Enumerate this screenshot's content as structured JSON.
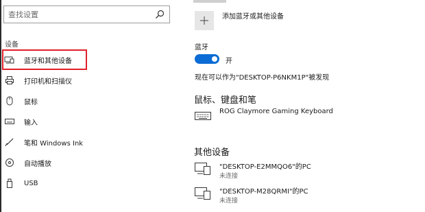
{
  "sidebar": {
    "search_placeholder": "查找设置",
    "section_label": "设备",
    "items": [
      {
        "label": "蓝牙和其他设备",
        "icon": "bluetooth-devices-icon"
      },
      {
        "label": "打印机和扫描仪",
        "icon": "printer-icon"
      },
      {
        "label": "鼠标",
        "icon": "mouse-icon"
      },
      {
        "label": "输入",
        "icon": "keyboard-icon"
      },
      {
        "label": "笔和 Windows Ink",
        "icon": "pen-icon"
      },
      {
        "label": "自动播放",
        "icon": "autoplay-icon"
      },
      {
        "label": "USB",
        "icon": "usb-icon"
      }
    ]
  },
  "main": {
    "add_device_label": "添加蓝牙或其他设备",
    "bluetooth": {
      "title": "蓝牙",
      "toggle_state": "开",
      "discoverable_text": "现在可以作为\"DESKTOP-P6NKM1P\"被发现"
    },
    "mouse_keyboard_pen": {
      "title": "鼠标、键盘和笔",
      "devices": [
        {
          "name": "ROG Claymore Gaming Keyboard",
          "icon": "keyboard-icon"
        }
      ]
    },
    "other_devices": {
      "title": "其他设备",
      "devices": [
        {
          "name": "\"DESKTOP-E2MMQO6\"的PC",
          "status": "未连接",
          "icon": "pc-icon"
        },
        {
          "name": "\"DESKTOP-M28QRMI\"的PC",
          "status": "未连接",
          "icon": "pc-icon"
        }
      ]
    }
  },
  "colors": {
    "accent": "#0a6cd4",
    "highlight": "#e0202a"
  }
}
